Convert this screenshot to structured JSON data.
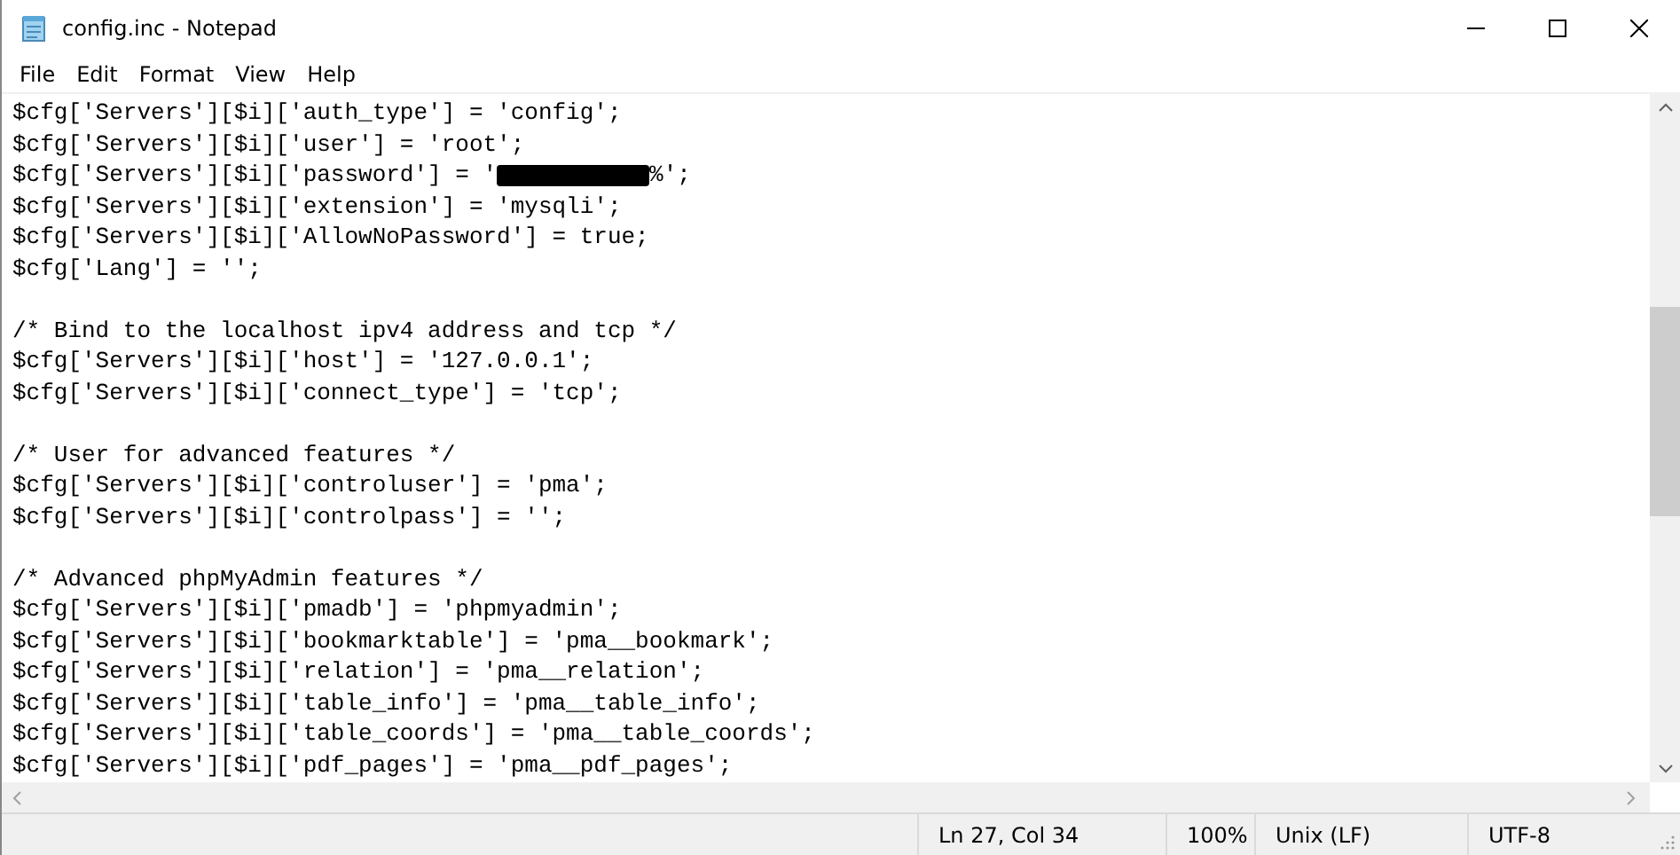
{
  "window": {
    "title": "config.inc - Notepad"
  },
  "menu": [
    "File",
    "Edit",
    "Format",
    "View",
    "Help"
  ],
  "lines": [
    {
      "kind": "code",
      "text": "$cfg['Servers'][$i]['auth_type'] = 'config';"
    },
    {
      "kind": "code",
      "text": "$cfg['Servers'][$i]['user'] = 'root';"
    },
    {
      "kind": "redacted",
      "before": "$cfg['Servers'][$i]['password'] = '",
      "after": "%';"
    },
    {
      "kind": "code",
      "text": "$cfg['Servers'][$i]['extension'] = 'mysqli';"
    },
    {
      "kind": "code",
      "text": "$cfg['Servers'][$i]['AllowNoPassword'] = true;"
    },
    {
      "kind": "code",
      "text": "$cfg['Lang'] = '';"
    },
    {
      "kind": "blank"
    },
    {
      "kind": "code",
      "text": "/* Bind to the localhost ipv4 address and tcp */"
    },
    {
      "kind": "code",
      "text": "$cfg['Servers'][$i]['host'] = '127.0.0.1';"
    },
    {
      "kind": "code",
      "text": "$cfg['Servers'][$i]['connect_type'] = 'tcp';"
    },
    {
      "kind": "blank"
    },
    {
      "kind": "code",
      "text": "/* User for advanced features */"
    },
    {
      "kind": "code",
      "text": "$cfg['Servers'][$i]['controluser'] = 'pma';"
    },
    {
      "kind": "code",
      "text": "$cfg['Servers'][$i]['controlpass'] = '';"
    },
    {
      "kind": "blank"
    },
    {
      "kind": "code",
      "text": "/* Advanced phpMyAdmin features */"
    },
    {
      "kind": "code",
      "text": "$cfg['Servers'][$i]['pmadb'] = 'phpmyadmin';"
    },
    {
      "kind": "code",
      "text": "$cfg['Servers'][$i]['bookmarktable'] = 'pma__bookmark';"
    },
    {
      "kind": "code",
      "text": "$cfg['Servers'][$i]['relation'] = 'pma__relation';"
    },
    {
      "kind": "code",
      "text": "$cfg['Servers'][$i]['table_info'] = 'pma__table_info';"
    },
    {
      "kind": "code",
      "text": "$cfg['Servers'][$i]['table_coords'] = 'pma__table_coords';"
    },
    {
      "kind": "code",
      "text": "$cfg['Servers'][$i]['pdf_pages'] = 'pma__pdf_pages';"
    }
  ],
  "status_bar": {
    "position": "Ln 27, Col 34",
    "zoom": "100%",
    "line_endings": "Unix (LF)",
    "encoding": "UTF-8"
  }
}
